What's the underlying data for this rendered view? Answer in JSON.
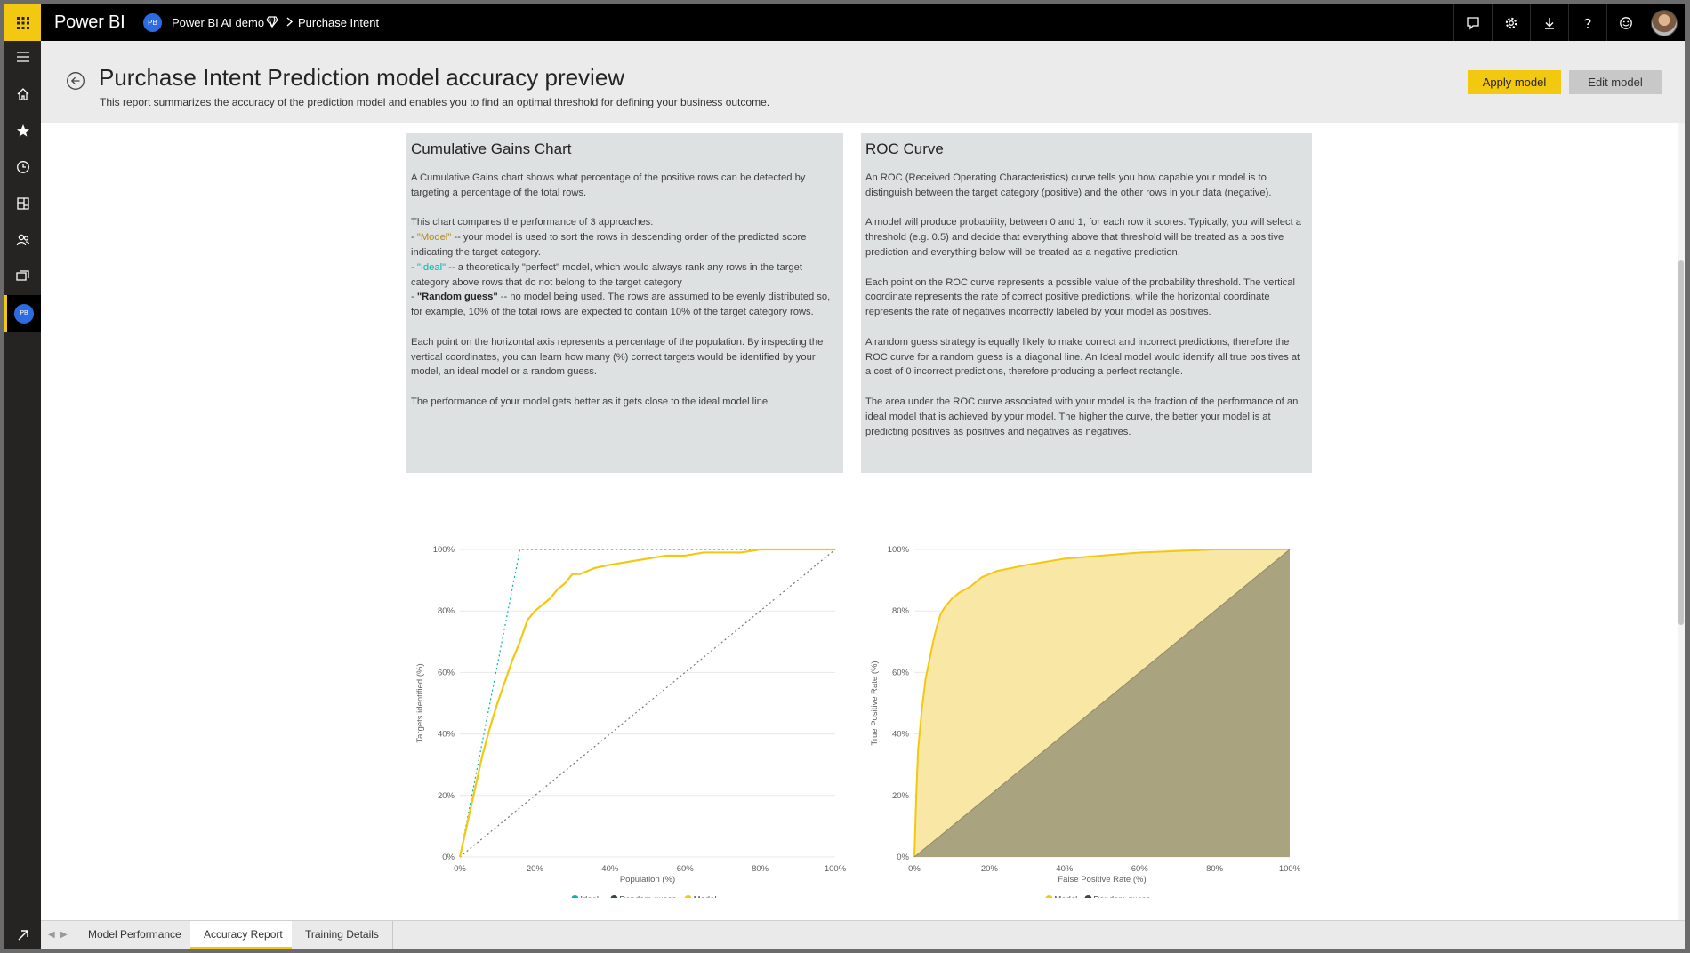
{
  "topbar": {
    "brand": "Power BI",
    "workspace_initials": "PB",
    "workspace_name": "Power BI AI demo",
    "current_page": "Purchase Intent",
    "icons": [
      "notifications-icon",
      "settings-gear-icon",
      "download-icon",
      "help-icon",
      "feedback-smiley-icon"
    ]
  },
  "leftnav": {
    "items": [
      "menu-icon",
      "home-icon",
      "favorites-star-icon",
      "recent-clock-icon",
      "apps-icon",
      "shared-with-me-icon",
      "workspaces-icon"
    ],
    "workspace_initials": "PB"
  },
  "header": {
    "title": "Purchase Intent Prediction model accuracy preview",
    "subtitle": "This report summarizes the accuracy of the prediction model and enables you to find an optimal threshold for defining your business outcome.",
    "apply_label": "Apply model",
    "edit_label": "Edit model"
  },
  "gains_card": {
    "title": "Cumulative Gains Chart",
    "p1": "A Cumulative Gains chart shows what percentage of the positive rows can be detected by targeting a percentage of the total rows.",
    "p2_intro": "This chart compares the performance of 3 approaches:",
    "model_dash": "- ",
    "model_term": "\"Model\"",
    "model_desc": " -- your model is used to sort the rows in descending order of the predicted score indicating the target category.",
    "ideal_dash": "- ",
    "ideal_term": "\"Ideal\"",
    "ideal_desc": " -- a theoretically \"perfect\" model, which would always rank any rows in the target category above rows that do not belong to the target category",
    "random_dash": "- ",
    "random_term": "\"Random guess\"",
    "random_desc": " -- no model being used. The rows are assumed to be evenly distributed so, for example, 10% of the total rows are expected to contain 10% of the target category rows.",
    "p3": "Each point on the horizontal axis represents a percentage of the population. By inspecting the vertical coordinates, you can learn how many (%) correct targets would be identified by your model, an ideal model or a random guess.",
    "p4": "The performance of your model gets better as it gets close to the ideal model line."
  },
  "roc_card": {
    "title": "ROC Curve",
    "p1": "An ROC (Received Operating Characteristics) curve tells you how capable your model is to distinguish between the target category (positive) and the other rows in your data (negative).",
    "p2": "A model will produce probability, between 0 and 1, for each row it scores. Typically, you will select a threshold (e.g. 0.5) and decide that everything above that threshold will be treated as a positive prediction and everything below will be treated as a negative prediction.",
    "p3": "Each point on the ROC curve represents a possible value of the probability threshold. The vertical coordinate represents the rate of correct positive predictions, while the horizontal coordinate represents the rate of negatives incorrectly labeled by your model as positives.",
    "p4": "A random guess strategy is equally likely to make correct and incorrect predictions, therefore the ROC curve for a random guess is a diagonal line. An Ideal model would identify all true positives at a cost of 0 incorrect predictions, therefore producing a perfect rectangle.",
    "p5": "The area under the ROC curve associated with your model is the fraction of the performance of an ideal model that is achieved by your model. The higher the curve, the better your model is at predicting positives as positives and negatives as negatives."
  },
  "colors": {
    "model": "#f2c811",
    "ideal": "#01b8aa",
    "random": "#374649",
    "roc_model_fill": "#f9e7a6",
    "roc_random_fill": "#a9a47f"
  },
  "chart_data": [
    {
      "type": "line",
      "xlabel": "Population (%)",
      "ylabel": "Targets identified (%)",
      "xlim": [
        0,
        100
      ],
      "ylim": [
        0,
        100
      ],
      "x_ticks": [
        "0%",
        "20%",
        "40%",
        "60%",
        "80%",
        "100%"
      ],
      "y_ticks": [
        "0%",
        "20%",
        "40%",
        "60%",
        "80%",
        "100%"
      ],
      "grid": true,
      "legend_position": "bottom-center",
      "legend": [
        "Ideal",
        "Random guess",
        "Model"
      ],
      "series": [
        {
          "name": "Ideal",
          "x": [
            0,
            16,
            100
          ],
          "y": [
            0,
            100,
            100
          ]
        },
        {
          "name": "Random guess",
          "x": [
            0,
            100
          ],
          "y": [
            0,
            100
          ]
        },
        {
          "name": "Model",
          "x": [
            0,
            2,
            4,
            6,
            8,
            10,
            12,
            14,
            16,
            18,
            20,
            22,
            24,
            26,
            28,
            30,
            32,
            34,
            36,
            40,
            45,
            50,
            55,
            60,
            65,
            70,
            75,
            80,
            90,
            100
          ],
          "y": [
            0,
            11,
            22,
            33,
            42,
            50,
            57,
            64,
            70,
            77,
            80,
            82,
            84,
            87,
            89,
            92,
            92,
            93,
            94,
            95,
            96,
            97,
            98,
            98,
            99,
            99,
            99,
            100,
            100,
            100
          ]
        }
      ]
    },
    {
      "type": "area",
      "xlabel": "False Positive Rate (%)",
      "ylabel": "True Positive Rate (%)",
      "xlim": [
        0,
        100
      ],
      "ylim": [
        0,
        100
      ],
      "x_ticks": [
        "0%",
        "20%",
        "40%",
        "60%",
        "80%",
        "100%"
      ],
      "y_ticks": [
        "0%",
        "20%",
        "40%",
        "60%",
        "80%",
        "100%"
      ],
      "grid": true,
      "legend_position": "bottom-center",
      "legend": [
        "Model",
        "Random guess"
      ],
      "series": [
        {
          "name": "Model",
          "x": [
            0,
            0.5,
            1,
            2,
            3,
            4,
            5,
            6,
            7,
            8,
            10,
            12,
            15,
            18,
            22,
            26,
            30,
            35,
            40,
            50,
            60,
            70,
            80,
            90,
            100
          ],
          "y": [
            0,
            20,
            35,
            48,
            58,
            64,
            70,
            75,
            79,
            81,
            84,
            86,
            88,
            91,
            93,
            94,
            95,
            96,
            97,
            98,
            99,
            99.5,
            100,
            100,
            100
          ]
        },
        {
          "name": "Random guess",
          "x": [
            0,
            100
          ],
          "y": [
            0,
            100
          ]
        }
      ]
    }
  ],
  "tabs": {
    "items": [
      {
        "label": "Model Performance"
      },
      {
        "label": "Accuracy Report"
      },
      {
        "label": "Training Details"
      }
    ]
  }
}
